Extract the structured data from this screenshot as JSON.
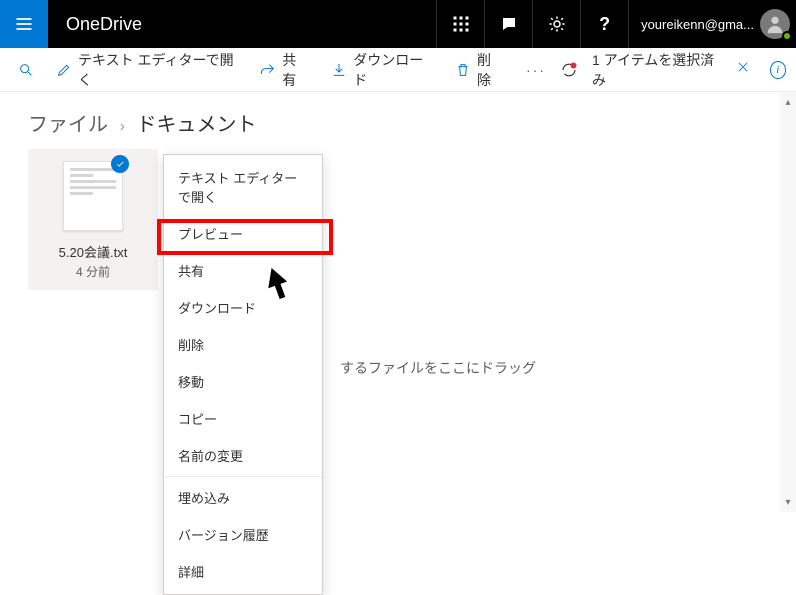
{
  "header": {
    "brand": "OneDrive",
    "account_display": "youreikenn@gma..."
  },
  "cmdbar": {
    "open_editor": "テキスト エディターで開く",
    "share": "共有",
    "download": "ダウンロード",
    "delete": "削除"
  },
  "selection_status": {
    "text": "1 アイテムを選択済み"
  },
  "breadcrumb": {
    "root": "ファイル",
    "current": "ドキュメント"
  },
  "file": {
    "name": "5.20会議.txt",
    "time": "4 分前"
  },
  "context_menu": {
    "items": [
      "テキスト エディターで開く",
      "プレビュー",
      "共有",
      "ダウンロード",
      "削除",
      "移動",
      "コピー",
      "名前の変更"
    ],
    "more_items": [
      "埋め込み",
      "バージョン履歴",
      "詳細"
    ]
  },
  "drag_hint": "するファイルをここにドラッグ"
}
